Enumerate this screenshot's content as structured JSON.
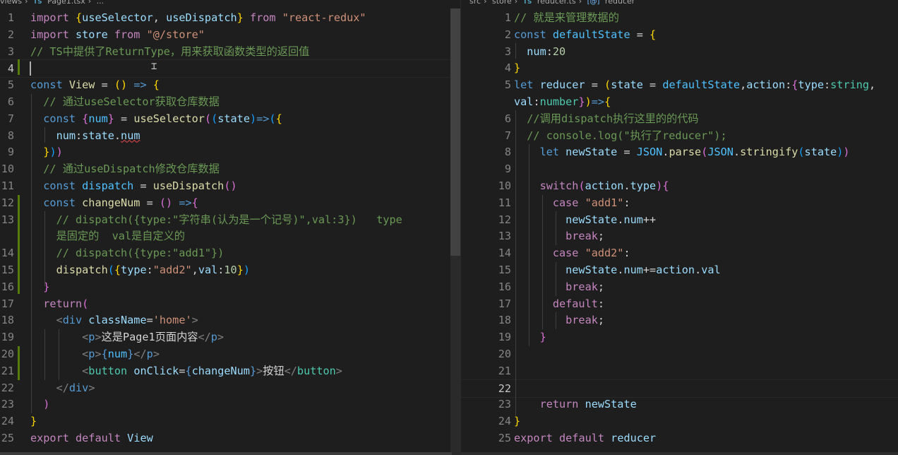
{
  "left": {
    "breadcrumb": [
      "views",
      "TS",
      "Page1.tsx",
      "..."
    ],
    "lines": [
      {
        "n": "1",
        "tokens": [
          [
            "kc",
            "import "
          ],
          [
            "b1",
            "{"
          ],
          [
            "v",
            "useSelector"
          ],
          [
            "p",
            ", "
          ],
          [
            "v",
            "useDispatch"
          ],
          [
            "b1",
            "}"
          ],
          [
            "kc",
            " from "
          ],
          [
            "s",
            "\"react-redux\""
          ]
        ]
      },
      {
        "n": "2",
        "tokens": [
          [
            "kc",
            "import "
          ],
          [
            "v",
            "store"
          ],
          [
            "kc",
            " from "
          ],
          [
            "s",
            "\"@/store\""
          ]
        ]
      },
      {
        "n": "3",
        "tokens": [
          [
            "cm",
            "// TS中提供了ReturnType，用来获取函数类型的返回值"
          ]
        ]
      },
      {
        "n": "4",
        "tokens": []
      },
      {
        "n": "5",
        "tokens": [
          [
            "k",
            "const "
          ],
          [
            "f",
            "View"
          ],
          [
            "p",
            " = "
          ],
          [
            "b1",
            "()"
          ],
          [
            "p",
            " "
          ],
          [
            "k",
            "=>"
          ],
          [
            "p",
            " "
          ],
          [
            "b1",
            "{"
          ]
        ]
      },
      {
        "n": "6",
        "tokens": [
          [
            "cm",
            "  // 通过useSelector获取仓库数据"
          ]
        ]
      },
      {
        "n": "7",
        "tokens": [
          [
            "k",
            "  const "
          ],
          [
            "b2",
            "{"
          ],
          [
            "c",
            "num"
          ],
          [
            "b2",
            "}"
          ],
          [
            "p",
            " = "
          ],
          [
            "f",
            "useSelector"
          ],
          [
            "b2",
            "("
          ],
          [
            "b3",
            "("
          ],
          [
            "v",
            "state"
          ],
          [
            "b3",
            ")"
          ],
          [
            "k",
            "=>"
          ],
          [
            "b3",
            "("
          ],
          [
            "b1",
            "{"
          ]
        ]
      },
      {
        "n": "8",
        "tokens": [
          [
            "v",
            "    num"
          ],
          [
            "p",
            ":"
          ],
          [
            "v",
            "state"
          ],
          [
            "p",
            "."
          ],
          [
            "v",
            "num",
            "squig"
          ]
        ]
      },
      {
        "n": "9",
        "tokens": [
          [
            "b1",
            "  }"
          ],
          [
            "b3",
            ")"
          ],
          [
            "b2",
            ")"
          ]
        ]
      },
      {
        "n": "10",
        "tokens": [
          [
            "cm",
            "  // 通过useDispatch修改仓库数据"
          ]
        ]
      },
      {
        "n": "11",
        "tokens": [
          [
            "k",
            "  const "
          ],
          [
            "c",
            "dispatch"
          ],
          [
            "p",
            " = "
          ],
          [
            "f",
            "useDispatch"
          ],
          [
            "b2",
            "()"
          ]
        ]
      },
      {
        "n": "12",
        "tokens": [
          [
            "k",
            "  const "
          ],
          [
            "f",
            "changeNum"
          ],
          [
            "p",
            " = "
          ],
          [
            "b2",
            "()"
          ],
          [
            "p",
            " "
          ],
          [
            "k",
            "=>"
          ],
          [
            "b2",
            "{"
          ]
        ]
      },
      {
        "n": "13",
        "tokens": [
          [
            "cm",
            "    // dispatch({type:\"字符串(认为是一个记号)\",val:3})   type"
          ]
        ]
      },
      {
        "n": "",
        "tokens": [
          [
            "cm",
            "    是固定的  val是自定义的"
          ]
        ]
      },
      {
        "n": "14",
        "tokens": [
          [
            "cm",
            "    // dispatch({type:\"add1\"})"
          ]
        ]
      },
      {
        "n": "15",
        "tokens": [
          [
            "f",
            "    dispatch"
          ],
          [
            "b3",
            "("
          ],
          [
            "b1",
            "{"
          ],
          [
            "v",
            "type"
          ],
          [
            "p",
            ":"
          ],
          [
            "s",
            "\"add2\""
          ],
          [
            "p",
            ","
          ],
          [
            "v",
            "val"
          ],
          [
            "p",
            ":"
          ],
          [
            "n",
            "10"
          ],
          [
            "b1",
            "}"
          ],
          [
            "b3",
            ")"
          ]
        ]
      },
      {
        "n": "16",
        "tokens": [
          [
            "b2",
            "  }"
          ]
        ]
      },
      {
        "n": "17",
        "tokens": [
          [
            "kc",
            "  return"
          ],
          [
            "b2",
            "("
          ]
        ]
      },
      {
        "n": "18",
        "tokens": [
          [
            "tagp",
            "    <"
          ],
          [
            "tag",
            "div"
          ],
          [
            "v",
            " className"
          ],
          [
            "p",
            "="
          ],
          [
            "s",
            "'home'"
          ],
          [
            "tagp",
            ">"
          ]
        ]
      },
      {
        "n": "19",
        "tokens": [
          [
            "tagp",
            "        <"
          ],
          [
            "tag",
            "p"
          ],
          [
            "tagp",
            ">"
          ],
          [
            "p",
            "这是Page1页面内容"
          ],
          [
            "tagp",
            "</"
          ],
          [
            "tag",
            "p"
          ],
          [
            "tagp",
            ">"
          ]
        ]
      },
      {
        "n": "20",
        "tokens": [
          [
            "tagp",
            "        <"
          ],
          [
            "tag",
            "p"
          ],
          [
            "tagp",
            ">"
          ],
          [
            "k",
            "{"
          ],
          [
            "c",
            "num"
          ],
          [
            "k",
            "}"
          ],
          [
            "tagp",
            "</"
          ],
          [
            "tag",
            "p"
          ],
          [
            "tagp",
            ">"
          ]
        ]
      },
      {
        "n": "21",
        "tokens": [
          [
            "tagp",
            "        <"
          ],
          [
            "t",
            "button"
          ],
          [
            "v",
            " onClick"
          ],
          [
            "p",
            "="
          ],
          [
            "k",
            "{"
          ],
          [
            "v",
            "changeNum"
          ],
          [
            "k",
            "}"
          ],
          [
            "tagp",
            ">"
          ],
          [
            "p",
            "按钮"
          ],
          [
            "tagp",
            "</"
          ],
          [
            "t",
            "button"
          ],
          [
            "tagp",
            ">"
          ]
        ]
      },
      {
        "n": "22",
        "tokens": [
          [
            "tagp",
            "    </"
          ],
          [
            "tag",
            "div"
          ],
          [
            "tagp",
            ">"
          ]
        ]
      },
      {
        "n": "23",
        "tokens": [
          [
            "b2",
            "  )"
          ]
        ]
      },
      {
        "n": "24",
        "tokens": [
          [
            "b1",
            "}"
          ]
        ]
      },
      {
        "n": "25",
        "tokens": [
          [
            "kc",
            "export "
          ],
          [
            "kc",
            "default "
          ],
          [
            "v",
            "View"
          ]
        ]
      }
    ]
  },
  "right": {
    "breadcrumb": [
      "src",
      "store",
      "TS",
      "reducer.ts",
      "[@]",
      "reducer"
    ],
    "lines": [
      {
        "n": "1",
        "tokens": [
          [
            "cm",
            "// 就是来管理数据的"
          ]
        ]
      },
      {
        "n": "2",
        "tokens": [
          [
            "k",
            "const "
          ],
          [
            "c",
            "defaultState"
          ],
          [
            "p",
            " = "
          ],
          [
            "b1",
            "{"
          ]
        ]
      },
      {
        "n": "3",
        "tokens": [
          [
            "v",
            "  num"
          ],
          [
            "p",
            ":"
          ],
          [
            "n",
            "20"
          ]
        ]
      },
      {
        "n": "4",
        "tokens": [
          [
            "b1",
            "}"
          ]
        ]
      },
      {
        "n": "5",
        "tokens": [
          [
            "k",
            "let "
          ],
          [
            "v",
            "reducer"
          ],
          [
            "p",
            " = "
          ],
          [
            "b1",
            "("
          ],
          [
            "v",
            "state"
          ],
          [
            "p",
            " = "
          ],
          [
            "c",
            "defaultState"
          ],
          [
            "p",
            ","
          ],
          [
            "v",
            "action"
          ],
          [
            "p",
            ":"
          ],
          [
            "b2",
            "{"
          ],
          [
            "v",
            "type"
          ],
          [
            "p",
            ":"
          ],
          [
            "t",
            "string"
          ],
          [
            "p",
            ","
          ]
        ]
      },
      {
        "n": "",
        "tokens": [
          [
            "v",
            "val"
          ],
          [
            "p",
            ":"
          ],
          [
            "t",
            "number"
          ],
          [
            "b2",
            "}"
          ],
          [
            "b1",
            ")"
          ],
          [
            "k",
            "=>"
          ],
          [
            "b1",
            "{"
          ]
        ]
      },
      {
        "n": "6",
        "tokens": [
          [
            "cm",
            "  //调用dispatch执行这里的的代码"
          ]
        ]
      },
      {
        "n": "7",
        "tokens": [
          [
            "cm",
            "  // console.log(\"执行了reducer\");"
          ]
        ]
      },
      {
        "n": "8",
        "tokens": [
          [
            "k",
            "    let "
          ],
          [
            "v",
            "newState"
          ],
          [
            "p",
            " = "
          ],
          [
            "c",
            "JSON"
          ],
          [
            "p",
            "."
          ],
          [
            "f",
            "parse"
          ],
          [
            "b2",
            "("
          ],
          [
            "c",
            "JSON"
          ],
          [
            "p",
            "."
          ],
          [
            "f",
            "stringify"
          ],
          [
            "b3",
            "("
          ],
          [
            "v",
            "state"
          ],
          [
            "b3",
            ")"
          ],
          [
            "b2",
            ")"
          ]
        ]
      },
      {
        "n": "9",
        "tokens": []
      },
      {
        "n": "10",
        "tokens": [
          [
            "kc",
            "    switch"
          ],
          [
            "b2",
            "("
          ],
          [
            "v",
            "action"
          ],
          [
            "p",
            "."
          ],
          [
            "v",
            "type"
          ],
          [
            "b2",
            ")"
          ],
          [
            "b2",
            "{"
          ]
        ]
      },
      {
        "n": "11",
        "tokens": [
          [
            "kc",
            "      case "
          ],
          [
            "s",
            "\"add1\""
          ],
          [
            "p",
            ":"
          ]
        ]
      },
      {
        "n": "12",
        "tokens": [
          [
            "v",
            "        newState"
          ],
          [
            "p",
            "."
          ],
          [
            "v",
            "num"
          ],
          [
            "p",
            "++"
          ]
        ]
      },
      {
        "n": "13",
        "tokens": [
          [
            "kc",
            "        break"
          ],
          [
            "p",
            ";"
          ]
        ]
      },
      {
        "n": "14",
        "tokens": [
          [
            "kc",
            "      case "
          ],
          [
            "s",
            "\"add2\""
          ],
          [
            "p",
            ":"
          ]
        ]
      },
      {
        "n": "15",
        "tokens": [
          [
            "v",
            "        newState"
          ],
          [
            "p",
            "."
          ],
          [
            "v",
            "num"
          ],
          [
            "p",
            "+="
          ],
          [
            "v",
            "action"
          ],
          [
            "p",
            "."
          ],
          [
            "v",
            "val"
          ]
        ]
      },
      {
        "n": "16",
        "tokens": [
          [
            "kc",
            "        break"
          ],
          [
            "p",
            ";"
          ]
        ]
      },
      {
        "n": "17",
        "tokens": [
          [
            "kc",
            "      default"
          ],
          [
            "p",
            ":"
          ]
        ]
      },
      {
        "n": "18",
        "tokens": [
          [
            "kc",
            "        break"
          ],
          [
            "p",
            ";"
          ]
        ]
      },
      {
        "n": "19",
        "tokens": [
          [
            "b2",
            "    }"
          ]
        ]
      },
      {
        "n": "20",
        "tokens": []
      },
      {
        "n": "21",
        "tokens": []
      },
      {
        "n": "22",
        "tokens": []
      },
      {
        "n": "23",
        "tokens": [
          [
            "kc",
            "    return "
          ],
          [
            "v",
            "newState"
          ]
        ]
      },
      {
        "n": "24",
        "tokens": [
          [
            "b1",
            "}"
          ]
        ]
      },
      {
        "n": "25",
        "tokens": [
          [
            "kc",
            "export "
          ],
          [
            "kc",
            "default "
          ],
          [
            "v",
            "reducer"
          ]
        ]
      }
    ]
  }
}
